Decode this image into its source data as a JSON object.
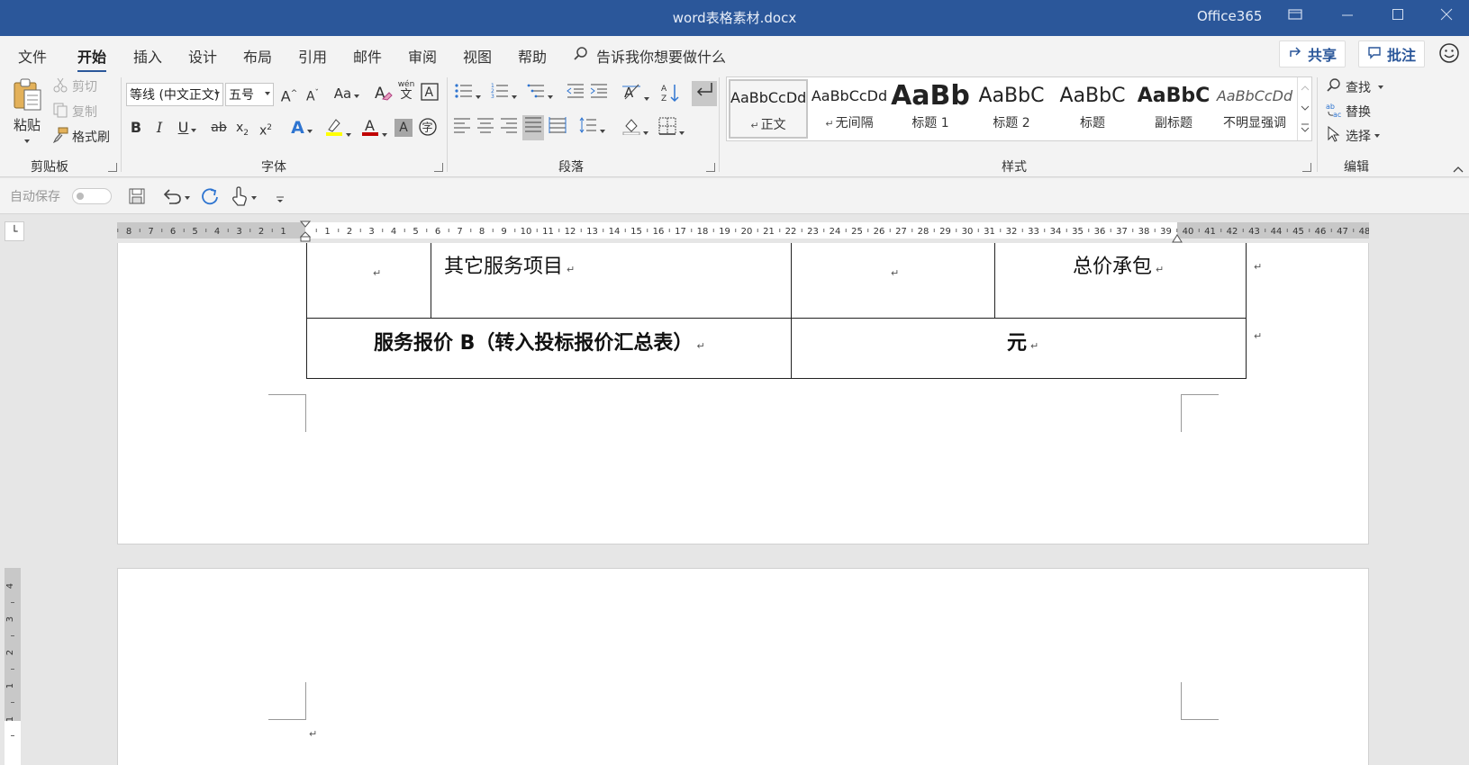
{
  "window": {
    "title": "word表格素材.docx",
    "account": "Office365"
  },
  "menu": {
    "tabs": [
      "文件",
      "开始",
      "插入",
      "设计",
      "布局",
      "引用",
      "邮件",
      "审阅",
      "视图",
      "帮助"
    ],
    "tell_me": "告诉我你想要做什么",
    "share_label": "共享",
    "comment_label": "批注"
  },
  "clipboard": {
    "paste": "粘贴",
    "cut": "剪切",
    "copy": "复制",
    "format_painter": "格式刷",
    "group_label": "剪贴板"
  },
  "font": {
    "font_name": "等线 (中文正文)",
    "font_size": "五号",
    "group_label": "字体",
    "phonetic_label": "wén"
  },
  "paragraph": {
    "group_label": "段落"
  },
  "styles": {
    "items": [
      {
        "sample": "AaBbCcDd",
        "name": "正文",
        "mark": "↵"
      },
      {
        "sample": "AaBbCcDd",
        "name": "无间隔",
        "mark": "↵"
      },
      {
        "sample": "AaBb",
        "name": "标题 1",
        "mark": ""
      },
      {
        "sample": "AaBbC",
        "name": "标题 2",
        "mark": ""
      },
      {
        "sample": "AaBbC",
        "name": "标题",
        "mark": ""
      },
      {
        "sample": "AaBbC",
        "name": "副标题",
        "mark": ""
      },
      {
        "sample": "AaBbCcDd",
        "name": "不明显强调",
        "mark": ""
      }
    ],
    "group_label": "样式"
  },
  "editing": {
    "find": "查找",
    "replace": "替换",
    "select": "选择",
    "group_label": "编辑"
  },
  "quick_access": {
    "autosave_label": "自动保存"
  },
  "ruler": {
    "left_numbers": [
      8,
      7,
      6,
      5,
      4,
      3,
      2,
      1
    ],
    "right_numbers": [
      1,
      2,
      3,
      4,
      5,
      6,
      7,
      8,
      9,
      10,
      11,
      12,
      13,
      14,
      15,
      16,
      17,
      18,
      19,
      20,
      21,
      22,
      23,
      24,
      25,
      26,
      27,
      28,
      29,
      30,
      31,
      32,
      33,
      34,
      35,
      36,
      37,
      38,
      39,
      40,
      41,
      42,
      43,
      44,
      45,
      46,
      47,
      48
    ],
    "vertical_numbers": [
      4,
      3,
      2,
      1,
      1
    ]
  },
  "document": {
    "table": {
      "row1": {
        "col1": "",
        "col2": "其它服务项目",
        "col3": "",
        "col4": "总价承包"
      },
      "row2": {
        "label": "服务报价 B（转入投标报价汇总表）",
        "value": "元"
      },
      "cell_mark": "↵"
    },
    "paragraph_mark": "↵"
  }
}
